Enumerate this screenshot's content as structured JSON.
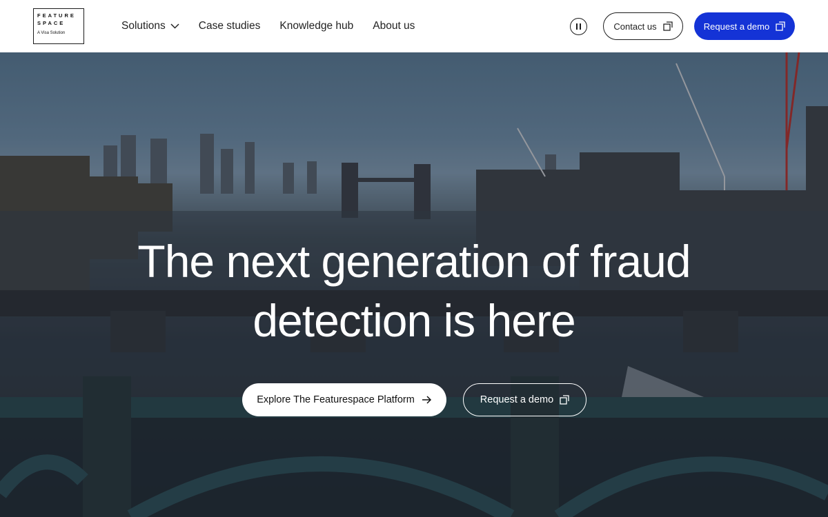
{
  "brand": {
    "logo_line1": "FEATURE",
    "logo_line2": "SPACE",
    "logo_sub": "A Visa Solution"
  },
  "nav": {
    "items": [
      {
        "label": "Solutions",
        "has_dropdown": true
      },
      {
        "label": "Case studies"
      },
      {
        "label": "Knowledge hub"
      },
      {
        "label": "About us"
      }
    ]
  },
  "header_actions": {
    "pause_icon": "pause-icon",
    "contact_label": "Contact us",
    "demo_label": "Request a demo",
    "external_icon": "external-link-icon"
  },
  "hero": {
    "title_line1": "The next generation of fraud",
    "title_line2": "detection is here",
    "explore_label": "Explore The Featurespace Platform",
    "demo_label": "Request a demo"
  },
  "colors": {
    "accent": "#1433d6",
    "text_dark": "#222222",
    "white": "#ffffff"
  }
}
